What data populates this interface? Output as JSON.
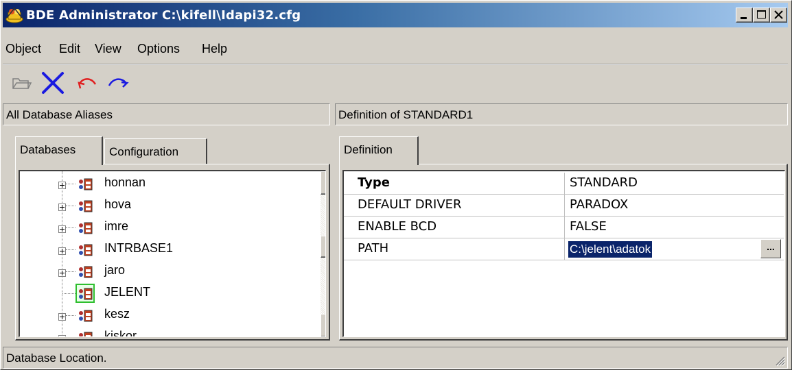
{
  "window": {
    "title": "BDE Administrator  C:\\kifell\\Idapi32.cfg",
    "app_icon": "bde-admin-icon",
    "controls": [
      "minimize-icon",
      "maximize-icon",
      "close-icon"
    ]
  },
  "menu": {
    "items": [
      {
        "label": "Object"
      },
      {
        "label": "Edit"
      },
      {
        "label": "View"
      },
      {
        "label": "Options"
      },
      {
        "label": "Help"
      }
    ]
  },
  "toolbar": {
    "buttons": [
      {
        "icon": "open-folder-icon",
        "enabled": false
      },
      {
        "icon": "delete-x-icon",
        "enabled": true
      },
      {
        "icon": "undo-icon",
        "enabled": true
      },
      {
        "icon": "redo-icon",
        "enabled": true
      }
    ]
  },
  "left_panel": {
    "header": "All Database Aliases",
    "tabs": [
      {
        "label": "Databases",
        "active": true
      },
      {
        "label": "Configuration",
        "active": false
      }
    ],
    "tree_items": [
      {
        "label": "honnan",
        "expandable": true,
        "selected": false
      },
      {
        "label": "hova",
        "expandable": true,
        "selected": false
      },
      {
        "label": "imre",
        "expandable": true,
        "selected": false
      },
      {
        "label": "INTRBASE1",
        "expandable": true,
        "selected": false
      },
      {
        "label": "jaro",
        "expandable": true,
        "selected": false
      },
      {
        "label": "JELENT",
        "expandable": false,
        "selected": true
      },
      {
        "label": "kesz",
        "expandable": true,
        "selected": false
      },
      {
        "label": "kiskor",
        "expandable": true,
        "selected": false
      }
    ]
  },
  "right_panel": {
    "header": "Definition of STANDARD1",
    "tabs": [
      {
        "label": "Definition",
        "active": true
      }
    ],
    "rows": [
      {
        "name": "Type",
        "value": "STANDARD",
        "bold": true
      },
      {
        "name": "DEFAULT DRIVER",
        "value": "PARADOX",
        "bold": false
      },
      {
        "name": "ENABLE BCD",
        "value": "FALSE",
        "bold": false
      },
      {
        "name": "PATH",
        "value": "C:\\jelent\\adatok",
        "bold": false,
        "editing": true,
        "button": "..."
      }
    ]
  },
  "status": {
    "text": "Database Location."
  },
  "colors": {
    "face": "#d4d0c8",
    "title_start": "#0a246a",
    "title_end": "#a6caf0",
    "selection": "#0a246a"
  }
}
